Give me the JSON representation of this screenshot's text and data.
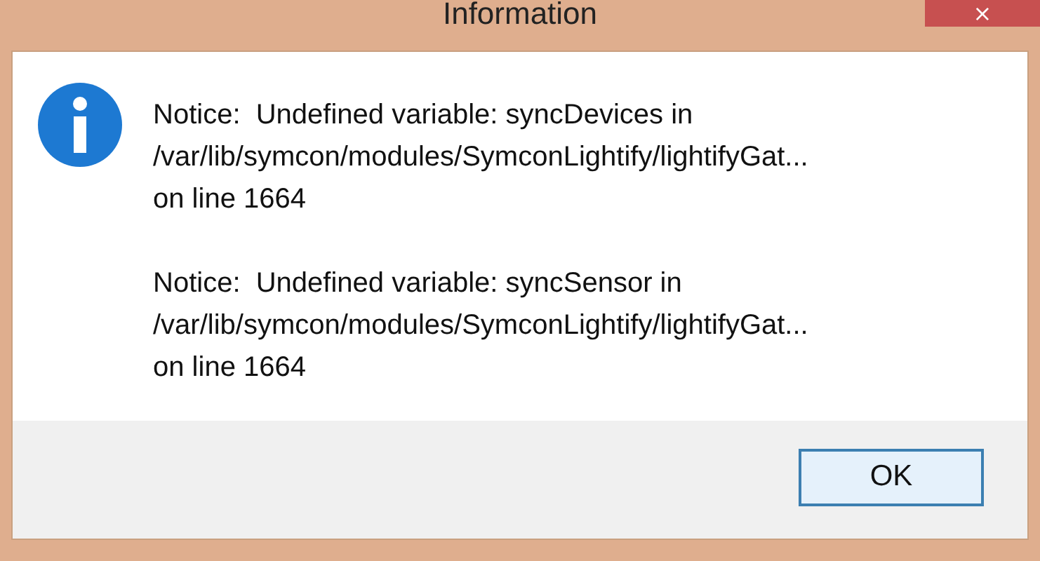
{
  "window": {
    "title": "Information",
    "close": "×"
  },
  "messages": [
    {
      "lines": [
        "Notice:  Undefined variable: syncDevices in",
        "/var/lib/symcon/modules/SymconLightify/lightifyGat...",
        "on line 1664"
      ]
    },
    {
      "lines": [
        "Notice:  Undefined variable: syncSensor in",
        "/var/lib/symcon/modules/SymconLightify/lightifyGat...",
        "on line 1664"
      ]
    }
  ],
  "buttons": [
    {
      "label": "OK",
      "default": true
    }
  ]
}
